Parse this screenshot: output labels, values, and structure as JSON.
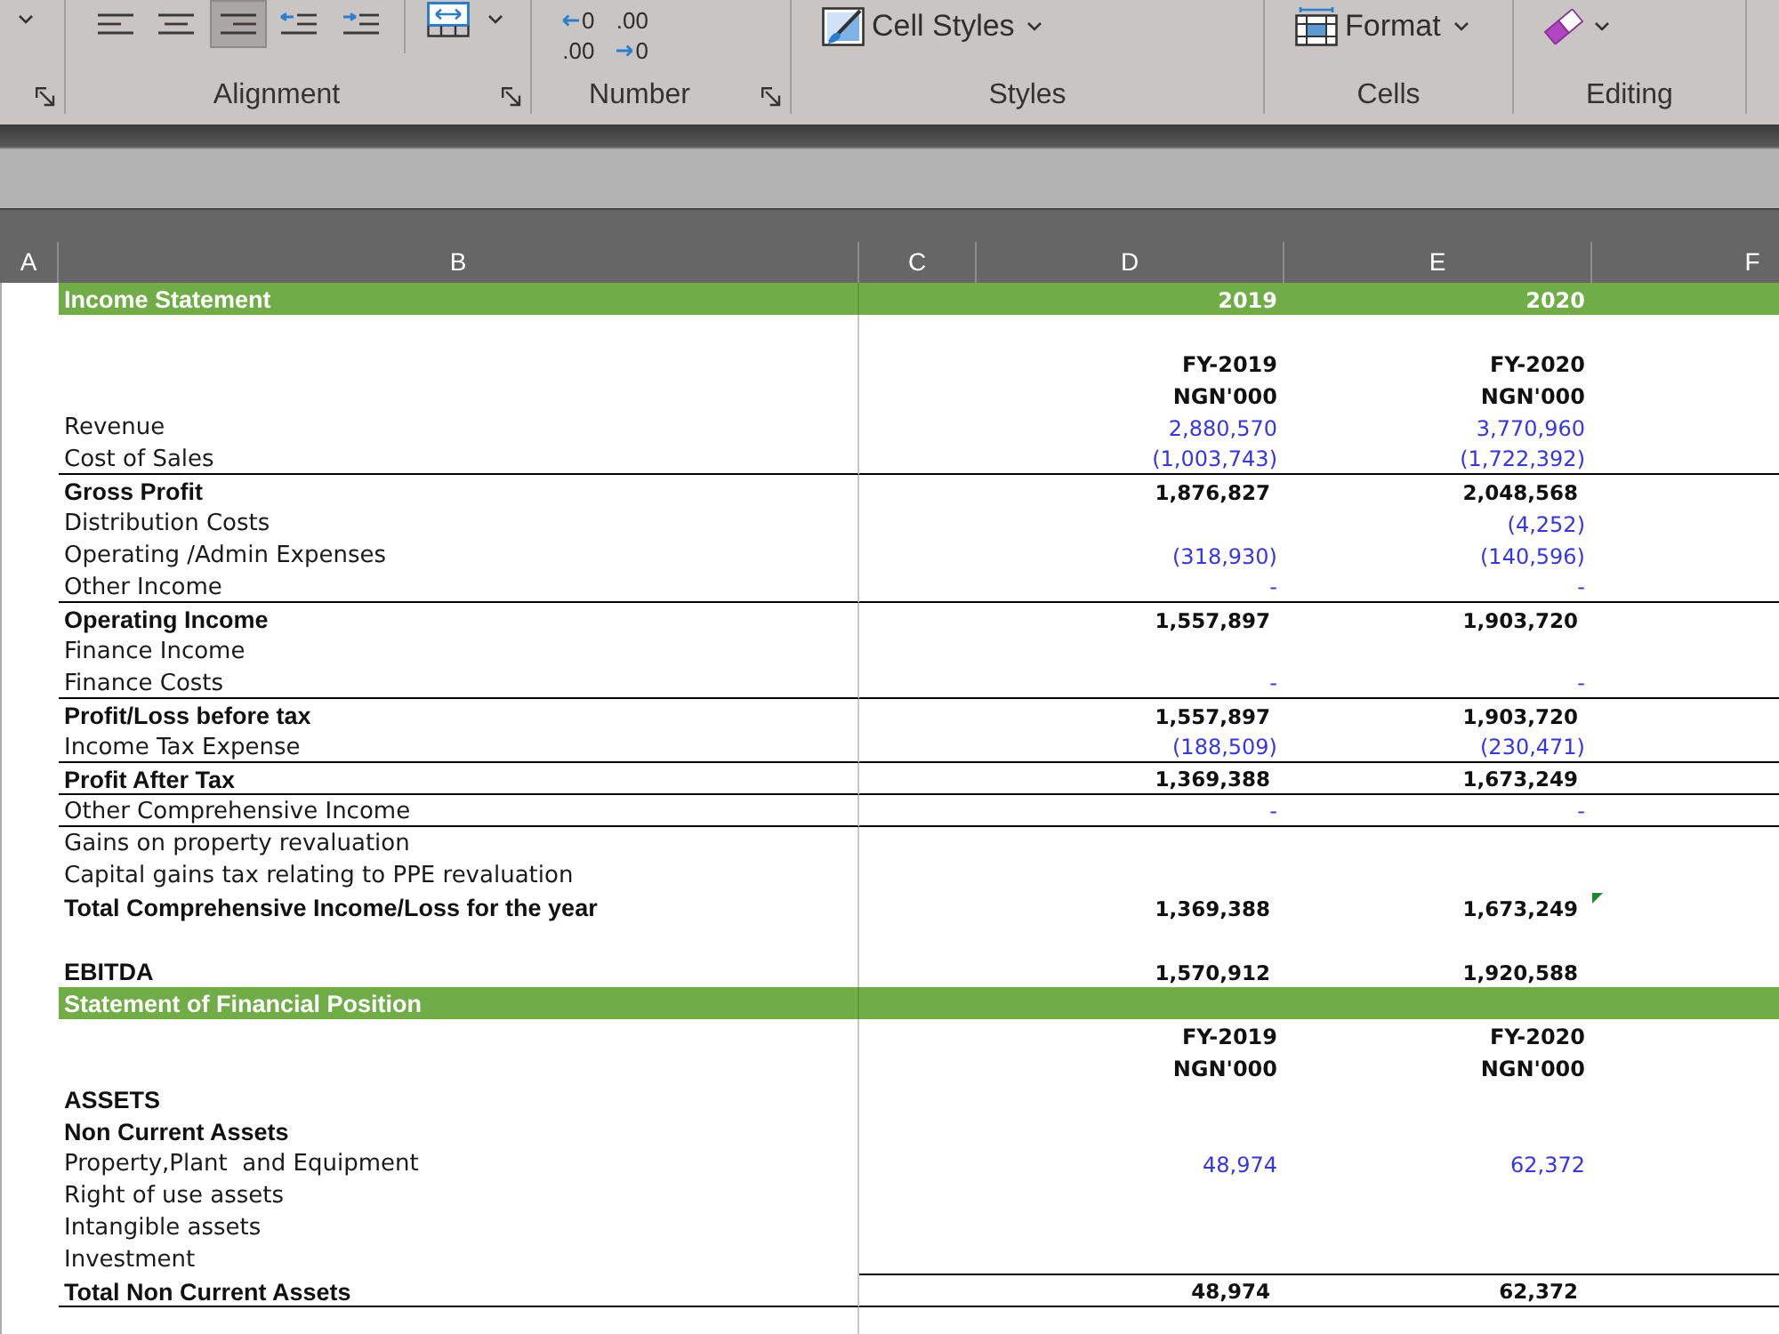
{
  "ribbon": {
    "groups": [
      {
        "dialog_launcher": true,
        "tools": [
          {
            "kind": "offscreen",
            "dropdown": true
          }
        ]
      },
      {
        "label": "Alignment",
        "dialog_launcher": true,
        "tools": [
          {
            "kind": "align-left",
            "selected": false,
            "dropdown": false
          },
          {
            "kind": "align-center",
            "selected": false,
            "dropdown": false
          },
          {
            "kind": "align-right",
            "selected": true,
            "dropdown": false
          },
          {
            "kind": "decrease-indent",
            "selected": false,
            "dropdown": false
          },
          {
            "kind": "increase-indent",
            "selected": false,
            "dropdown": false
          },
          {
            "kind": "merge-center",
            "selected": false,
            "dropdown": true
          }
        ]
      },
      {
        "label": "Number",
        "dialog_launcher": true,
        "tools": [
          {
            "kind": "decrease-decimal",
            "upper": "0",
            "lower": ".00",
            "dropdown": false
          },
          {
            "kind": "increase-decimal",
            "upper": ".00",
            "lower": "0",
            "dropdown": false
          }
        ]
      },
      {
        "label": "Styles",
        "dialog_launcher": false,
        "tools": [
          {
            "kind": "cell-styles",
            "text": "Cell Styles",
            "dropdown": true
          }
        ]
      },
      {
        "label": "Cells",
        "dialog_launcher": false,
        "tools": [
          {
            "kind": "format",
            "text": "Format",
            "dropdown": true
          }
        ]
      },
      {
        "label": "Editing",
        "dialog_launcher": false,
        "tools": [
          {
            "kind": "clear",
            "dropdown": true
          }
        ]
      }
    ]
  },
  "sheet": {
    "columns": [
      "A",
      "B",
      "C",
      "D",
      "E",
      "F"
    ],
    "rows": [
      {
        "kind": "section",
        "label": "Income Statement",
        "d": "2019",
        "e": "2020",
        "rule_below": false,
        "value_rule_below": false,
        "flagged": false
      },
      {
        "kind": "blank",
        "rule_below": false,
        "value_rule_below": false,
        "flagged": false
      },
      {
        "kind": "header",
        "d": "FY-2019",
        "e": "FY-2020",
        "rule_below": false,
        "value_rule_below": false,
        "flagged": false
      },
      {
        "kind": "header",
        "d": "NGN'000",
        "e": "NGN'000",
        "rule_below": false,
        "value_rule_below": false,
        "flagged": false
      },
      {
        "kind": "item",
        "label": "Revenue",
        "d": "2,880,570",
        "e": "3,770,960",
        "rule_below": false,
        "value_rule_below": false,
        "flagged": false
      },
      {
        "kind": "item",
        "label": "Cost of Sales",
        "d": "(1,003,743)",
        "e": "(1,722,392)",
        "rule_below": true,
        "value_rule_below": false,
        "flagged": false
      },
      {
        "kind": "total",
        "label": "Gross Profit",
        "d": "1,876,827",
        "e": "2,048,568",
        "rule_below": false,
        "value_rule_below": false,
        "flagged": false
      },
      {
        "kind": "item",
        "label": "Distribution Costs",
        "e": "(4,252)",
        "rule_below": false,
        "value_rule_below": false,
        "flagged": false
      },
      {
        "kind": "item",
        "label": "Operating /Admin Expenses",
        "d": "(318,930)",
        "e": "(140,596)",
        "rule_below": false,
        "value_rule_below": false,
        "flagged": false
      },
      {
        "kind": "item",
        "label": "Other Income",
        "d": "-",
        "e": "-",
        "rule_below": true,
        "value_rule_below": false,
        "flagged": false
      },
      {
        "kind": "total",
        "label": "Operating Income",
        "d": "1,557,897",
        "e": "1,903,720",
        "rule_below": false,
        "value_rule_below": false,
        "flagged": false
      },
      {
        "kind": "item",
        "label": "Finance Income",
        "rule_below": false,
        "value_rule_below": false,
        "flagged": false
      },
      {
        "kind": "item",
        "label": "Finance Costs",
        "d": "-",
        "e": "-",
        "rule_below": true,
        "value_rule_below": false,
        "flagged": false
      },
      {
        "kind": "total",
        "label": "Profit/Loss before tax",
        "d": "1,557,897",
        "e": "1,903,720",
        "rule_below": false,
        "value_rule_below": false,
        "flagged": false
      },
      {
        "kind": "item",
        "label": "Income Tax Expense",
        "d": "(188,509)",
        "e": "(230,471)",
        "rule_below": true,
        "value_rule_below": false,
        "flagged": false
      },
      {
        "kind": "total",
        "label": "Profit After Tax",
        "d": "1,369,388",
        "e": "1,673,249",
        "rule_below": true,
        "value_rule_below": false,
        "flagged": false
      },
      {
        "kind": "item",
        "label": "Other Comprehensive Income",
        "d": "-",
        "e": "-",
        "rule_below": true,
        "value_rule_below": false,
        "flagged": false
      },
      {
        "kind": "item",
        "label": "Gains on property revaluation",
        "rule_below": false,
        "value_rule_below": false,
        "flagged": false
      },
      {
        "kind": "item",
        "label": "Capital gains tax relating to PPE revaluation",
        "rule_below": false,
        "value_rule_below": false,
        "flagged": false
      },
      {
        "kind": "total",
        "label": "Total Comprehensive Income/Loss for the year",
        "d": "1,369,388",
        "e": "1,673,249",
        "rule_below": false,
        "value_rule_below": false,
        "flagged": true
      },
      {
        "kind": "blank",
        "rule_below": false,
        "value_rule_below": false,
        "flagged": false
      },
      {
        "kind": "total",
        "label": "EBITDA",
        "d": "1,570,912",
        "e": "1,920,588",
        "rule_below": false,
        "value_rule_below": false,
        "flagged": false
      },
      {
        "kind": "section",
        "label": "Statement of Financial Position",
        "rule_below": false,
        "value_rule_below": false,
        "flagged": false
      },
      {
        "kind": "header",
        "d": "FY-2019",
        "e": "FY-2020",
        "rule_below": false,
        "value_rule_below": false,
        "flagged": false
      },
      {
        "kind": "header",
        "d": "NGN'000",
        "e": "NGN'000",
        "rule_below": false,
        "value_rule_below": false,
        "flagged": false
      },
      {
        "kind": "total",
        "label": "ASSETS",
        "rule_below": false,
        "value_rule_below": false,
        "flagged": false
      },
      {
        "kind": "total",
        "label": "Non Current Assets",
        "rule_below": false,
        "value_rule_below": false,
        "flagged": false
      },
      {
        "kind": "item",
        "label": "Property,Plant  and Equipment",
        "d": "48,974",
        "e": "62,372",
        "rule_below": false,
        "value_rule_below": false,
        "flagged": false
      },
      {
        "kind": "item",
        "label": "Right of use assets",
        "rule_below": false,
        "value_rule_below": false,
        "flagged": false
      },
      {
        "kind": "item",
        "label": "Intangible assets",
        "rule_below": false,
        "value_rule_below": false,
        "flagged": false
      },
      {
        "kind": "item",
        "label": "Investment",
        "rule_below": false,
        "value_rule_below": true,
        "flagged": false
      },
      {
        "kind": "total",
        "label": "Total Non Current Assets",
        "d": "48,974",
        "e": "62,372",
        "rule_below": true,
        "value_rule_below": false,
        "flagged": false
      }
    ]
  }
}
